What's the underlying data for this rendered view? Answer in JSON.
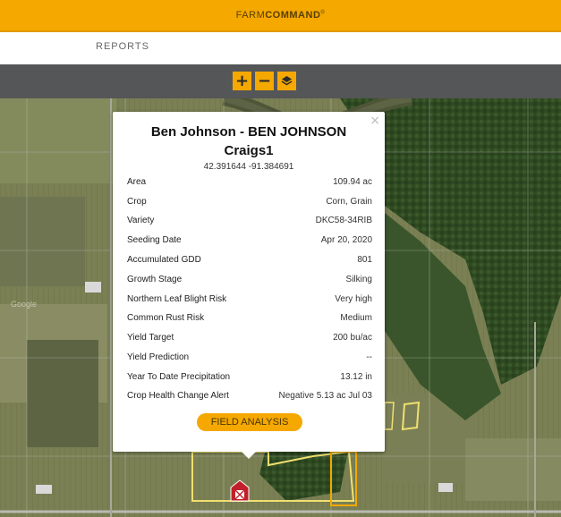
{
  "header": {
    "logo_text_light": "FARM",
    "logo_text_bold": "COMMAND",
    "logo_mark": "®"
  },
  "nav": {
    "reports_label": "REPORTS"
  },
  "toolbar": {
    "zoom_in": "+",
    "zoom_out": "−",
    "layers_icon": "layers-icon"
  },
  "popup": {
    "title_line1": "Ben Johnson - BEN JOHNSON",
    "title_line2": "Craigs1",
    "coordinates": "42.391644 -91.384691",
    "close": "×",
    "rows": [
      {
        "label": "Area",
        "value": "109.94 ac"
      },
      {
        "label": "Crop",
        "value": "Corn, Grain"
      },
      {
        "label": "Variety",
        "value": "DKC58-34RIB"
      },
      {
        "label": "Seeding Date",
        "value": "Apr 20, 2020"
      },
      {
        "label": "Accumulated GDD",
        "value": "801"
      },
      {
        "label": "Growth Stage",
        "value": "Silking"
      },
      {
        "label": "Northern Leaf Blight Risk",
        "value": "Very high"
      },
      {
        "label": "Common Rust Risk",
        "value": "Medium"
      },
      {
        "label": "Yield Target",
        "value": "200 bu/ac"
      },
      {
        "label": "Yield Prediction",
        "value": "--"
      },
      {
        "label": "Year To Date Precipitation",
        "value": "13.12 in"
      },
      {
        "label": "Crop Health Change Alert",
        "value": "Negative 5.13 ac Jul 03"
      }
    ],
    "field_analysis_label": "FIELD ANALYSIS"
  },
  "map": {
    "watermark": "Google",
    "barn_icon": "barn-icon"
  },
  "colors": {
    "brand": "#f5a800",
    "toolbar": "#555657",
    "field_outline": "#f0e070",
    "field_outline_alt": "#f5a800"
  }
}
